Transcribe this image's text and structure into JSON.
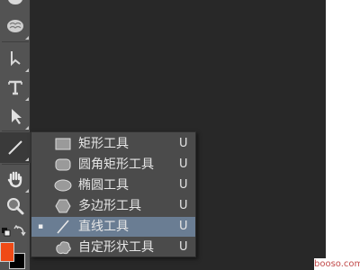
{
  "toolbar": {
    "tools": [
      {
        "name": "sponge-tool",
        "icon": "sponge-icon"
      },
      {
        "name": "blur-tool",
        "icon": "brain-icon"
      },
      {
        "name": "pen-tool",
        "icon": "pen-icon"
      },
      {
        "name": "type-tool",
        "icon": "type-icon"
      },
      {
        "name": "path-selection-tool",
        "icon": "arrow-icon"
      },
      {
        "name": "line-tool",
        "icon": "line-icon"
      },
      {
        "name": "hand-tool",
        "icon": "hand-icon"
      },
      {
        "name": "zoom-tool",
        "icon": "zoom-icon"
      }
    ],
    "foreground_color": "#f04a16",
    "background_color": "#000000"
  },
  "shape_menu": {
    "items": [
      {
        "label": "矩形工具",
        "shortcut": "U",
        "icon": "rectangle-icon",
        "selected": false
      },
      {
        "label": "圆角矩形工具",
        "shortcut": "U",
        "icon": "rounded-rectangle-icon",
        "selected": false
      },
      {
        "label": "椭圆工具",
        "shortcut": "U",
        "icon": "ellipse-icon",
        "selected": false
      },
      {
        "label": "多边形工具",
        "shortcut": "U",
        "icon": "polygon-icon",
        "selected": false
      },
      {
        "label": "直线工具",
        "shortcut": "U",
        "icon": "line-icon",
        "selected": true,
        "marker": "▪"
      },
      {
        "label": "自定形状工具",
        "shortcut": "U",
        "icon": "custom-shape-icon",
        "selected": false
      }
    ]
  },
  "watermark": "booso.com"
}
